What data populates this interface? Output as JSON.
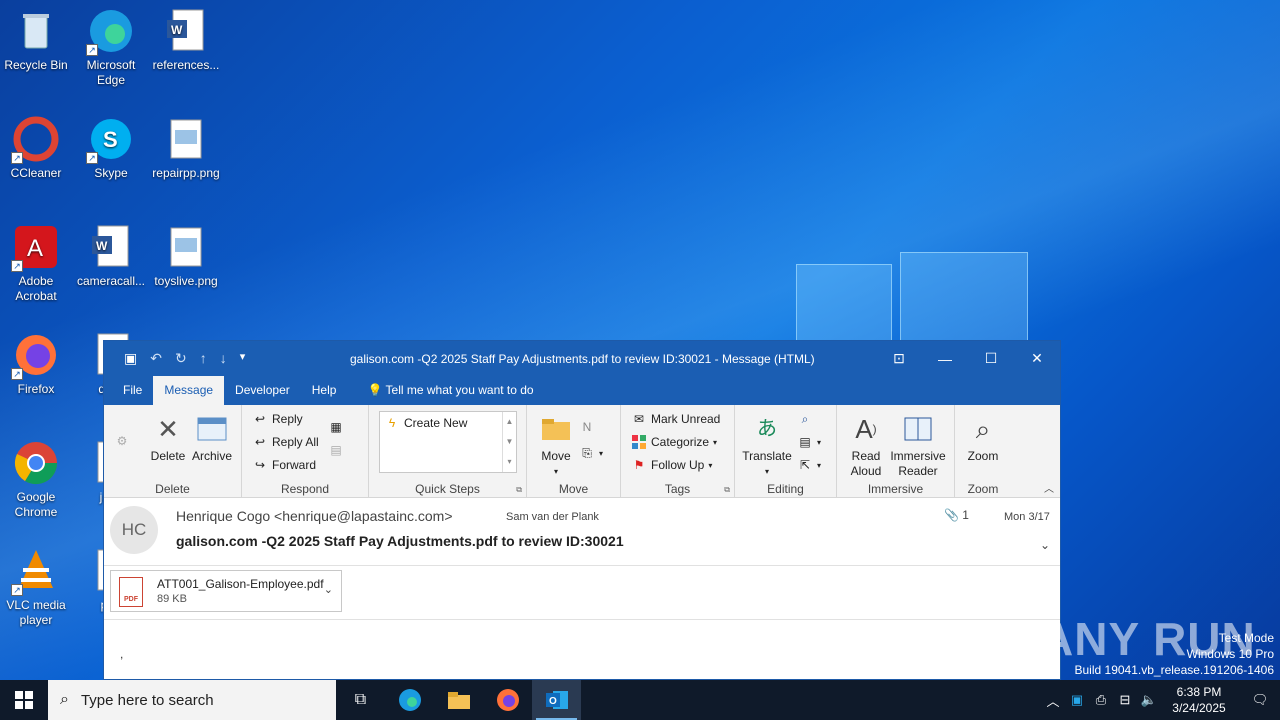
{
  "desktop": {
    "icons": [
      {
        "label": "Recycle Bin"
      },
      {
        "label": "Microsoft Edge"
      },
      {
        "label": "references..."
      },
      {
        "label": "CCleaner"
      },
      {
        "label": "Skype"
      },
      {
        "label": "repairpp.png"
      },
      {
        "label": "Adobe Acrobat"
      },
      {
        "label": "cameracall..."
      },
      {
        "label": "toyslive.png"
      },
      {
        "label": "Firefox"
      },
      {
        "label": "desc"
      },
      {
        "label": "Google Chrome"
      },
      {
        "label": "janu"
      },
      {
        "label": "VLC media player"
      },
      {
        "label": "prot"
      }
    ]
  },
  "window": {
    "title": "galison.com -Q2 2025 Staff Pay Adjustments.pdf to review ID:30021  -  Message (HTML)",
    "tabs": [
      "File",
      "Message",
      "Developer",
      "Help"
    ],
    "active_tab": "Message",
    "tell_me": "Tell me what you want to do"
  },
  "ribbon": {
    "delete_group": {
      "label": "Delete",
      "delete": "Delete",
      "archive": "Archive"
    },
    "respond_group": {
      "label": "Respond",
      "reply": "Reply",
      "reply_all": "Reply All",
      "forward": "Forward"
    },
    "quick_steps_group": {
      "label": "Quick Steps",
      "create_new": "Create New"
    },
    "move_group": {
      "label": "Move",
      "move": "Move"
    },
    "tags_group": {
      "label": "Tags",
      "mark_unread": "Mark Unread",
      "categorize": "Categorize",
      "follow_up": "Follow Up"
    },
    "editing_group": {
      "label": "Editing",
      "translate": "Translate"
    },
    "immersive_group": {
      "label": "Immersive",
      "read_aloud_1": "Read",
      "read_aloud_2": "Aloud",
      "immersive_reader_1": "Immersive",
      "immersive_reader_2": "Reader"
    },
    "zoom_group": {
      "label": "Zoom",
      "zoom": "Zoom"
    }
  },
  "message": {
    "avatar_initials": "HC",
    "from": "Henrique Cogo <henrique@lapastainc.com>",
    "to": "Sam van der Plank",
    "attachment_count": "1",
    "date": "Mon 3/17",
    "subject": "galison.com -Q2 2025 Staff Pay Adjustments.pdf to review ID:30021",
    "attachment": {
      "name": "ATT001_Galison-Employee.pdf",
      "size": "89 KB",
      "badge": "PDF"
    },
    "body": ","
  },
  "overlay": {
    "watermark": "ANY RUN",
    "test_mode": "Test Mode",
    "os": "Windows 10 Pro",
    "build": "Build 19041.vb_release.191206-1406"
  },
  "taskbar": {
    "search_placeholder": "Type here to search",
    "time": "6:38 PM",
    "date": "3/24/2025"
  }
}
